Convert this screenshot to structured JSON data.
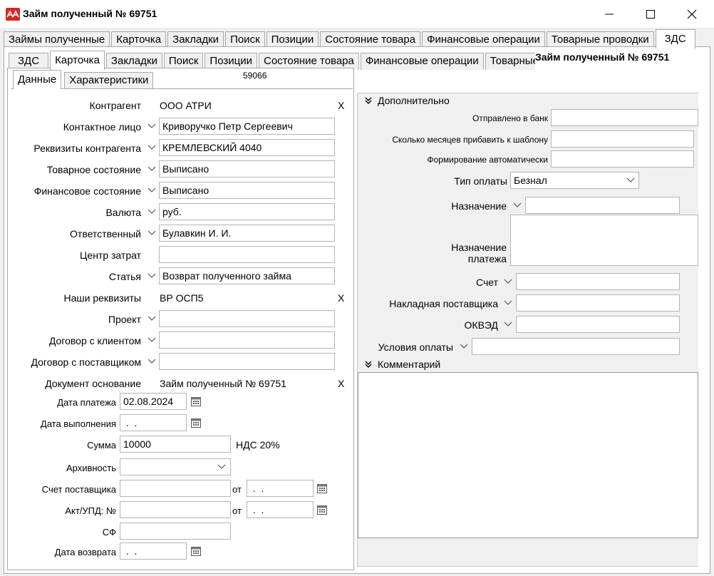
{
  "window": {
    "title": "Займ полученный № 69751",
    "colors": {
      "logo": "#d8271f",
      "active_tab": "#ffffff",
      "panel": "#f0f0f0"
    }
  },
  "tabs_top": [
    "Займы полученные",
    "Карточка",
    "Закладки",
    "Поиск",
    "Позиции",
    "Состояние товара",
    "Финансовые операции",
    "Товарные проводки",
    "ЗДС"
  ],
  "tabs_second": [
    "ЗДС",
    "Карточка",
    "Закладки",
    "Поиск",
    "Позиции",
    "Состояние товара",
    "Финансовые операции",
    "Товарные"
  ],
  "tabs_third": [
    "Данные",
    "Характеристики"
  ],
  "doc_header": "Займ полученный № 69751",
  "doc_number_box": "59066",
  "left": {
    "kontragent": {
      "label": "Контрагент",
      "value": "ООО АТРИ",
      "clear": "X"
    },
    "kontakt": {
      "label": "Контактное лицо",
      "value": "Криворучко Петр Сергеевич"
    },
    "rekvizity": {
      "label": "Реквизиты контрагента",
      "value": "КРЕМЛЕВСКИЙ 4040"
    },
    "tovar_state": {
      "label": "Товарное состояние",
      "value": "Выписано"
    },
    "fin_state": {
      "label": "Финансовое состояние",
      "value": "Выписано"
    },
    "valuta": {
      "label": "Валюта",
      "value": "руб."
    },
    "otvetstv": {
      "label": "Ответственный",
      "value": "Булавкин И. И."
    },
    "centr": {
      "label": "Центр затрат",
      "value": ""
    },
    "statya": {
      "label": "Статья",
      "value": "Возврат полученного займа"
    },
    "nashi": {
      "label": "Наши реквизиты",
      "value": "ВР ОСП5",
      "clear": "X"
    },
    "proekt": {
      "label": "Проект",
      "value": ""
    },
    "dog_klient": {
      "label": "Договор с клиентом",
      "value": ""
    },
    "dog_post": {
      "label": "Договор с поставщиком",
      "value": ""
    },
    "doc_osn": {
      "label": "Документ основание",
      "value": "Займ полученный № 69751",
      "clear": "X"
    },
    "data_plat": {
      "label": "Дата платежа",
      "value": "02.08.2024"
    },
    "data_vyp": {
      "label": "Дата выполнения",
      "value": " .  ."
    },
    "summa": {
      "label": "Сумма",
      "value": "10000",
      "nds": "НДС 20%"
    },
    "arhiv": {
      "label": "Архивность",
      "value": ""
    },
    "schet_post": {
      "label": "Счет поставщика",
      "value": "",
      "ot": "от",
      "date": " .  ."
    },
    "akt": {
      "label": "Акт/УПД: №",
      "value": "",
      "ot": "от",
      "date": " .  ."
    },
    "sf": {
      "label": "СФ",
      "value": ""
    },
    "data_vozvr": {
      "label": "Дата возврата",
      "value": " .  ."
    }
  },
  "right": {
    "section1": "Дополнительно",
    "otpr_bank": {
      "label": "Отправлено в банк",
      "value": ""
    },
    "mesyacev": {
      "label": "Сколько месяцев прибавить к шаблону",
      "value": ""
    },
    "form_auto": {
      "label": "Формирование автоматически",
      "value": ""
    },
    "tip_oplaty": {
      "label": "Тип оплаты",
      "value": "Безнал"
    },
    "naznach": {
      "label": "Назначение",
      "value": ""
    },
    "naznach_plat": {
      "label_1": "Назначение",
      "label_2": "платежа",
      "value": ""
    },
    "schet": {
      "label": "Счет",
      "value": ""
    },
    "nakladnaya": {
      "label": "Накладная поставщика",
      "value": ""
    },
    "okved": {
      "label": "ОКВЭД",
      "value": ""
    },
    "usloviya": {
      "label": "Условия оплаты",
      "value": ""
    },
    "section2": "Комментарий",
    "comment": ""
  },
  "icons": [
    "app-logo-icon",
    "minimize-icon",
    "maximize-icon",
    "close-icon",
    "chevron-down-icon",
    "calendar-icon",
    "double-chevron-icon"
  ]
}
